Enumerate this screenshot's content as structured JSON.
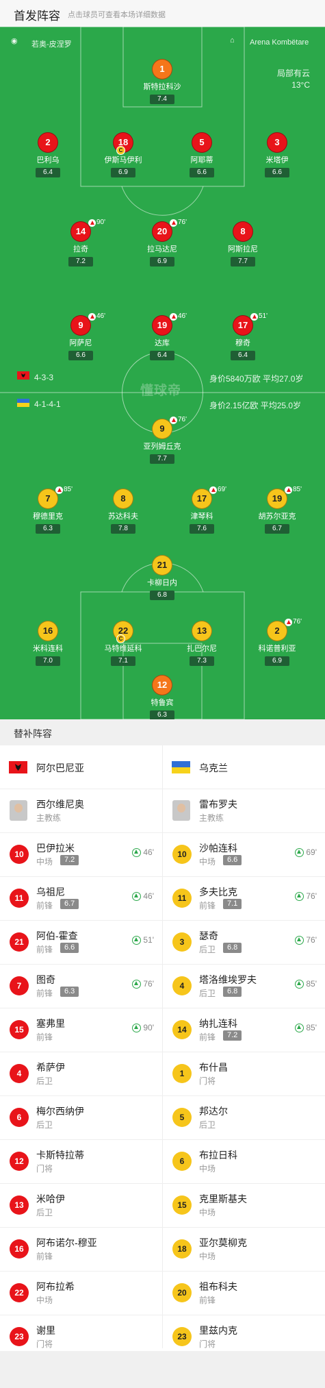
{
  "header": {
    "title": "首发阵容",
    "subtitle": "点击球员可查看本场详细数据"
  },
  "pitch": {
    "venue_left": "若奥-皮涅罗",
    "venue_right": "Arena Kombëtare",
    "weather_desc": "局部有云",
    "weather_temp": "13°C",
    "watermark": "懂球帝",
    "home_form": "4-3-3",
    "home_value": "身价5840万欧  平均27.0岁",
    "away_form": "4-1-4-1",
    "away_value": "身价2.15亿欧  平均25.0岁"
  },
  "home_players": [
    {
      "num": "1",
      "name": "斯特拉科沙",
      "rating": "7.4",
      "color": "org"
    },
    {
      "num": "2",
      "name": "巴利乌",
      "rating": "6.4",
      "color": "red"
    },
    {
      "num": "18",
      "name": "伊斯马伊利",
      "rating": "6.9",
      "color": "red",
      "captain": "C"
    },
    {
      "num": "5",
      "name": "阿耶蒂",
      "rating": "6.6",
      "color": "red"
    },
    {
      "num": "3",
      "name": "米塔伊",
      "rating": "6.6",
      "color": "red"
    },
    {
      "num": "14",
      "name": "拉奇",
      "rating": "7.2",
      "color": "red",
      "sub": "90'"
    },
    {
      "num": "20",
      "name": "拉马达尼",
      "rating": "6.9",
      "color": "red",
      "sub": "76'"
    },
    {
      "num": "8",
      "name": "阿斯拉尼",
      "rating": "7.7",
      "color": "red"
    },
    {
      "num": "9",
      "name": "阿萨尼",
      "rating": "6.6",
      "color": "red",
      "sub": "46'"
    },
    {
      "num": "19",
      "name": "达库",
      "rating": "6.4",
      "color": "red",
      "sub": "46'"
    },
    {
      "num": "17",
      "name": "穆奇",
      "rating": "6.4",
      "color": "red",
      "sub": "51'"
    }
  ],
  "away_players": [
    {
      "num": "9",
      "name": "亚列姆丘克",
      "rating": "7.7",
      "color": "yel",
      "sub": "76'"
    },
    {
      "num": "7",
      "name": "穆德里克",
      "rating": "6.3",
      "color": "yel",
      "sub": "85'"
    },
    {
      "num": "8",
      "name": "苏达科夫",
      "rating": "7.8",
      "color": "yel"
    },
    {
      "num": "17",
      "name": "津琴科",
      "rating": "7.6",
      "color": "yel",
      "sub": "69'"
    },
    {
      "num": "19",
      "name": "胡苏尔亚克",
      "rating": "6.7",
      "color": "yel",
      "sub": "85'"
    },
    {
      "num": "21",
      "name": "卡柳日内",
      "rating": "6.8",
      "color": "yel"
    },
    {
      "num": "16",
      "name": "米科连科",
      "rating": "7.0",
      "color": "yel"
    },
    {
      "num": "22",
      "name": "马特维延科",
      "rating": "7.1",
      "color": "yel",
      "captain": "C"
    },
    {
      "num": "13",
      "name": "扎巴尔尼",
      "rating": "7.3",
      "color": "yel"
    },
    {
      "num": "2",
      "name": "科诺普利亚",
      "rating": "6.9",
      "color": "yel",
      "sub": "76'"
    },
    {
      "num": "12",
      "name": "特鲁宾",
      "rating": "6.3",
      "color": "org"
    }
  ],
  "subs": {
    "title": "替补阵容",
    "home_team": "阿尔巴尼亚",
    "away_team": "乌克兰",
    "home_coach": {
      "name": "西尔维尼奥",
      "role": "主教练"
    },
    "away_coach": {
      "name": "雷布罗夫",
      "role": "主教练"
    },
    "home": [
      {
        "num": "10",
        "name": "巴伊拉米",
        "pos": "中场",
        "rating": "7.2",
        "ev": "46'"
      },
      {
        "num": "11",
        "name": "乌祖尼",
        "pos": "前锋",
        "rating": "6.7",
        "ev": "46'"
      },
      {
        "num": "21",
        "name": "阿伯-霍查",
        "pos": "前锋",
        "rating": "6.6",
        "ev": "51'"
      },
      {
        "num": "7",
        "name": "图奇",
        "pos": "前锋",
        "rating": "6.3",
        "ev": "76'"
      },
      {
        "num": "15",
        "name": "塞弗里",
        "pos": "前锋",
        "rating": "",
        "ev": "90'"
      },
      {
        "num": "4",
        "name": "希萨伊",
        "pos": "后卫",
        "rating": "",
        "ev": ""
      },
      {
        "num": "6",
        "name": "梅尔西纳伊",
        "pos": "后卫",
        "rating": "",
        "ev": ""
      },
      {
        "num": "12",
        "name": "卡斯特拉蒂",
        "pos": "门将",
        "rating": "",
        "ev": ""
      },
      {
        "num": "13",
        "name": "米哈伊",
        "pos": "后卫",
        "rating": "",
        "ev": ""
      },
      {
        "num": "16",
        "name": "阿布诺尔-穆亚",
        "pos": "前锋",
        "rating": "",
        "ev": ""
      },
      {
        "num": "22",
        "name": "阿布拉希",
        "pos": "中场",
        "rating": "",
        "ev": ""
      },
      {
        "num": "23",
        "name": "谢里",
        "pos": "门将",
        "rating": "",
        "ev": ""
      }
    ],
    "away": [
      {
        "num": "10",
        "name": "沙帕连科",
        "pos": "中场",
        "rating": "6.6",
        "ev": "69'"
      },
      {
        "num": "11",
        "name": "多夫比克",
        "pos": "前锋",
        "rating": "7.1",
        "ev": "76'"
      },
      {
        "num": "3",
        "name": "瑟奇",
        "pos": "后卫",
        "rating": "6.8",
        "ev": "76'"
      },
      {
        "num": "4",
        "name": "塔洛维埃罗夫",
        "pos": "后卫",
        "rating": "6.8",
        "ev": "85'"
      },
      {
        "num": "14",
        "name": "纳扎连科",
        "pos": "前锋",
        "rating": "7.2",
        "ev": "85'"
      },
      {
        "num": "1",
        "name": "布什昌",
        "pos": "门将",
        "rating": "",
        "ev": ""
      },
      {
        "num": "5",
        "name": "邦达尔",
        "pos": "后卫",
        "rating": "",
        "ev": ""
      },
      {
        "num": "6",
        "name": "布拉日科",
        "pos": "中场",
        "rating": "",
        "ev": ""
      },
      {
        "num": "15",
        "name": "克里斯基夫",
        "pos": "中场",
        "rating": "",
        "ev": ""
      },
      {
        "num": "18",
        "name": "亚尔莫柳克",
        "pos": "中场",
        "rating": "",
        "ev": ""
      },
      {
        "num": "20",
        "name": "祖布科夫",
        "pos": "前锋",
        "rating": "",
        "ev": ""
      },
      {
        "num": "23",
        "name": "里兹内克",
        "pos": "门将",
        "rating": "",
        "ev": ""
      }
    ]
  },
  "colors": {
    "pitch": "#2ba84a",
    "home": "#e8141a",
    "away": "#f6c51b",
    "gk_home": "#f5761a"
  }
}
